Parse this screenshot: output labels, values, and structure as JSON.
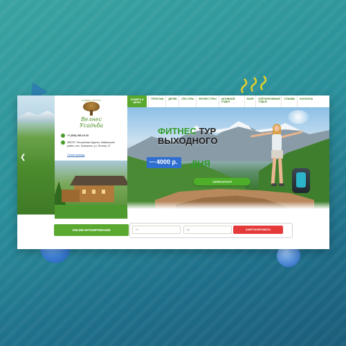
{
  "logo": {
    "subtitle": "отдых-отель",
    "name": "Велнес Усадьба"
  },
  "sidebar": {
    "phone": "+7 (928) 456-19-43",
    "address": "385757, Республика Адыгея, Майкопский район, пос. Гузерипль, ул. Лесная, 27",
    "route_link": "Схема проезда"
  },
  "nav": {
    "home_label": "НОМЕРА И ЦЕНЫ",
    "items": [
      "ТУРИСТАМ",
      "ДЕТЯМ",
      "СПА ТУРЫ",
      "ФИТНЕС ТУРЫ",
      "АКТИВНЫЙ ОТДЫХ",
      "БАНЯ",
      "КОРПОРАТИВНЫЙ ОТДЫХ",
      "ОТЗЫВЫ",
      "КОНТАКТЫ"
    ]
  },
  "hero": {
    "word_fitnes": "ФИТНЕС",
    "word_tur": "ТУР",
    "line2": "ВЫХОДНОГО",
    "line3": "ДНЯ",
    "price_prefix": "всего",
    "price": "4000 р.",
    "signup_label": "ЗАПИСАТЬСЯ"
  },
  "booking": {
    "label": "ONLINE БРОНИРОВАНИЕ",
    "from_placeholder": "От",
    "to_placeholder": "До",
    "button_label": "ЗАБРОНИРОВАТЬ"
  },
  "colors": {
    "accent_green": "#5aa82e",
    "price_blue": "#2f6fd0",
    "book_red": "#e53a3a"
  }
}
